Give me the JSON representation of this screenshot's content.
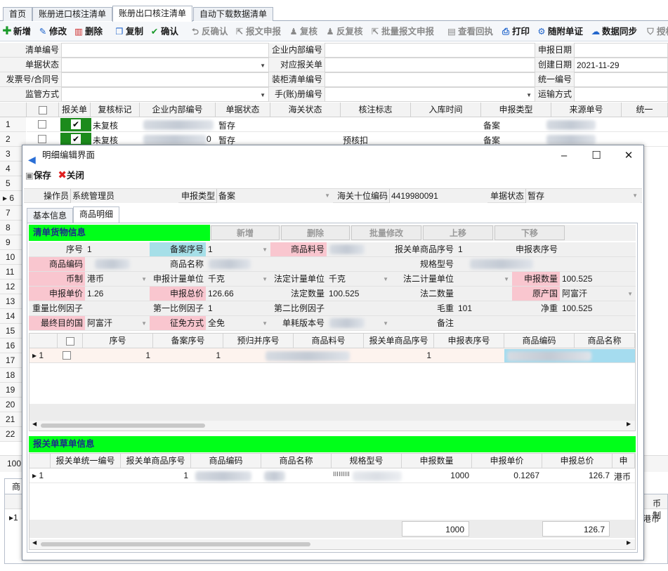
{
  "tabs": [
    "首页",
    "账册进口核注清单",
    "账册出口核注清单",
    "自动下载数据清单"
  ],
  "toolbar": {
    "add": "新增",
    "edit": "修改",
    "delete": "删除",
    "copy": "复制",
    "confirm": "确认",
    "unconfirm": "反确认",
    "declare": "报文申报",
    "review": "复核",
    "unreview": "反复核",
    "batch_declare": "批量报文申报",
    "view_receipt": "查看回执",
    "print": "打印",
    "attach": "随附单证",
    "sync": "数据同步",
    "auth": "授权"
  },
  "form": {
    "list_no": "清单编号",
    "doc_status": "单据状态",
    "invoice_no": "发票号/合同号",
    "supervision": "监管方式",
    "internal_no": "企业内部编号",
    "customs_decl": "对应报关单",
    "container_no": "装柜清单编号",
    "manual_no": "手(账)册编号",
    "decl_date": "申报日期",
    "create_date": "创建日期",
    "create_date_value": "2021-11-29",
    "unified_no": "统一编号",
    "transport": "运输方式"
  },
  "grid": {
    "headers": [
      "报关单",
      "复核标记",
      "企业内部编号",
      "单据状态",
      "海关状态",
      "核注标志",
      "入库时间",
      "申报类型",
      "来源单号",
      "统一"
    ],
    "rows": [
      {
        "num": "1",
        "review": "未复核",
        "internal_suffix": "",
        "status": "暂存",
        "flag": "",
        "type": "备案"
      },
      {
        "num": "2",
        "review": "未复核",
        "internal_suffix": "0",
        "status": "暂存",
        "flag": "预核扣",
        "type": "备案"
      }
    ],
    "row_numbers": [
      "3",
      "4",
      "5",
      "6",
      "7",
      "8",
      "9",
      "10",
      "11",
      "12",
      "13",
      "14",
      "15",
      "16",
      "17",
      "18",
      "19",
      "20",
      "21",
      "22"
    ],
    "bottom_100": "100",
    "bottom_tab": "商品",
    "bottom_col": "币制",
    "bottom_value": "港币",
    "bottom_rownum": "1"
  },
  "dialog": {
    "title": "明细编辑界面",
    "save": "保存",
    "close": "关闭",
    "operator_label": "操作员",
    "operator": "系统管理员",
    "decl_type_label": "申报类型",
    "decl_type": "备案",
    "hs_label": "海关十位编码",
    "hs": "4419980091",
    "status_label": "单据状态",
    "status": "暂存",
    "tab_basic": "基本信息",
    "tab_goods": "商品明细",
    "section1": "清单货物信息",
    "btn_add": "新增",
    "btn_del": "删除",
    "btn_batch": "批量修改",
    "btn_up": "上移",
    "btn_down": "下移",
    "fields": {
      "seq_l": "序号",
      "seq": "1",
      "rec_seq_l": "备案序号",
      "rec_seq": "1",
      "part_l": "商品料号",
      "decl_goods_seq_l": "报关单商品序号",
      "decl_goods_seq": "1",
      "decl_table_seq_l": "申报表序号",
      "code_l": "商品编码",
      "name_l": "商品名称",
      "spec_l": "规格型号",
      "curr_l": "币制",
      "curr": "港币",
      "unit_l": "申报计量单位",
      "unit": "千克",
      "legal_unit_l": "法定计量单位",
      "legal_unit": "千克",
      "legal2_unit_l": "法二计量单位",
      "qty_l": "申报数量",
      "qty": "100.525",
      "price_l": "申报单价",
      "price": "1.26",
      "total_l": "申报总价",
      "total": "126.66",
      "legal_qty_l": "法定数量",
      "legal_qty": "100.525",
      "legal2_qty_l": "法二数量",
      "origin_l": "原产国",
      "origin": "阿富汗",
      "weight_factor_l": "重量比例因子",
      "factor1_l": "第一比例因子",
      "factor1": "1",
      "factor2_l": "第二比例因子",
      "gross_l": "毛重",
      "gross": "101",
      "net_l": "净重",
      "net": "100.525",
      "dest_l": "最终目的国",
      "dest": "阿富汗",
      "tax_l": "征免方式",
      "tax": "全免",
      "version_l": "单耗版本号",
      "remark_l": "备注"
    },
    "subgrid": {
      "headers": [
        "序号",
        "备案序号",
        "预归并序号",
        "商品料号",
        "报关单商品序号",
        "申报表序号",
        "商品编码",
        "商品名称"
      ],
      "rownum": "1",
      "seq": "1",
      "rec_seq": "1",
      "decl_goods_seq": "1"
    },
    "section2": "报关单草单信息",
    "grid2": {
      "headers": [
        "报关单统一编号",
        "报关单商品序号",
        "商品编码",
        "商品名称",
        "规格型号",
        "申报数量",
        "申报单价",
        "申报总价",
        "申"
      ],
      "rownum": "1",
      "goods_seq": "1",
      "spec": "ⅠⅠⅠⅠⅠⅠⅠⅠⅠ",
      "qty": "1000",
      "price": "0.1267",
      "total": "126.7",
      "curr": "港币",
      "sum_qty": "1000",
      "sum_total": "126.7"
    }
  }
}
